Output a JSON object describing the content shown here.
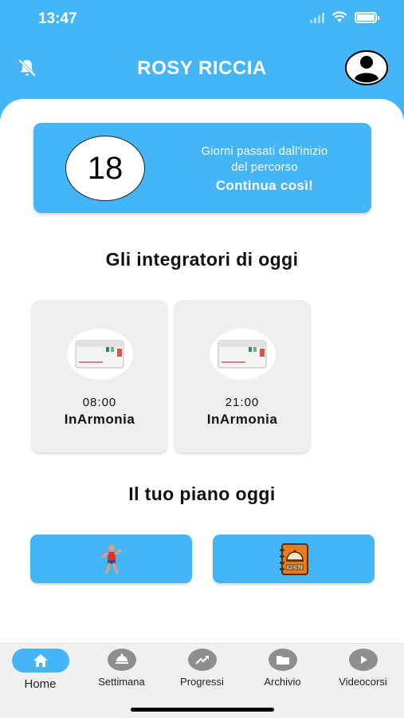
{
  "status_bar": {
    "time": "13:47"
  },
  "header": {
    "title": "ROSY RICCIA"
  },
  "days_card": {
    "count": "18",
    "caption_line1": "Giorni passati dall'inizio",
    "caption_line2": "del percorso",
    "cta": "Continua così!"
  },
  "supplements": {
    "title": "Gli integratori di oggi",
    "items": [
      {
        "time": "08:00",
        "name": "InArmonia"
      },
      {
        "time": "21:00",
        "name": "InArmonia"
      }
    ]
  },
  "plan": {
    "title": "Il tuo piano oggi"
  },
  "tabs": [
    {
      "label": "Home",
      "icon": "home-icon"
    },
    {
      "label": "Settimana",
      "icon": "food-icon"
    },
    {
      "label": "Progressi",
      "icon": "trend-icon"
    },
    {
      "label": "Archivio",
      "icon": "folder-icon"
    },
    {
      "label": "Videocorsi",
      "icon": "play-icon"
    }
  ],
  "colors": {
    "accent": "#44b5f6",
    "background": "#ffffff",
    "card": "#efefef",
    "tabbar": "#f0f0f0"
  }
}
